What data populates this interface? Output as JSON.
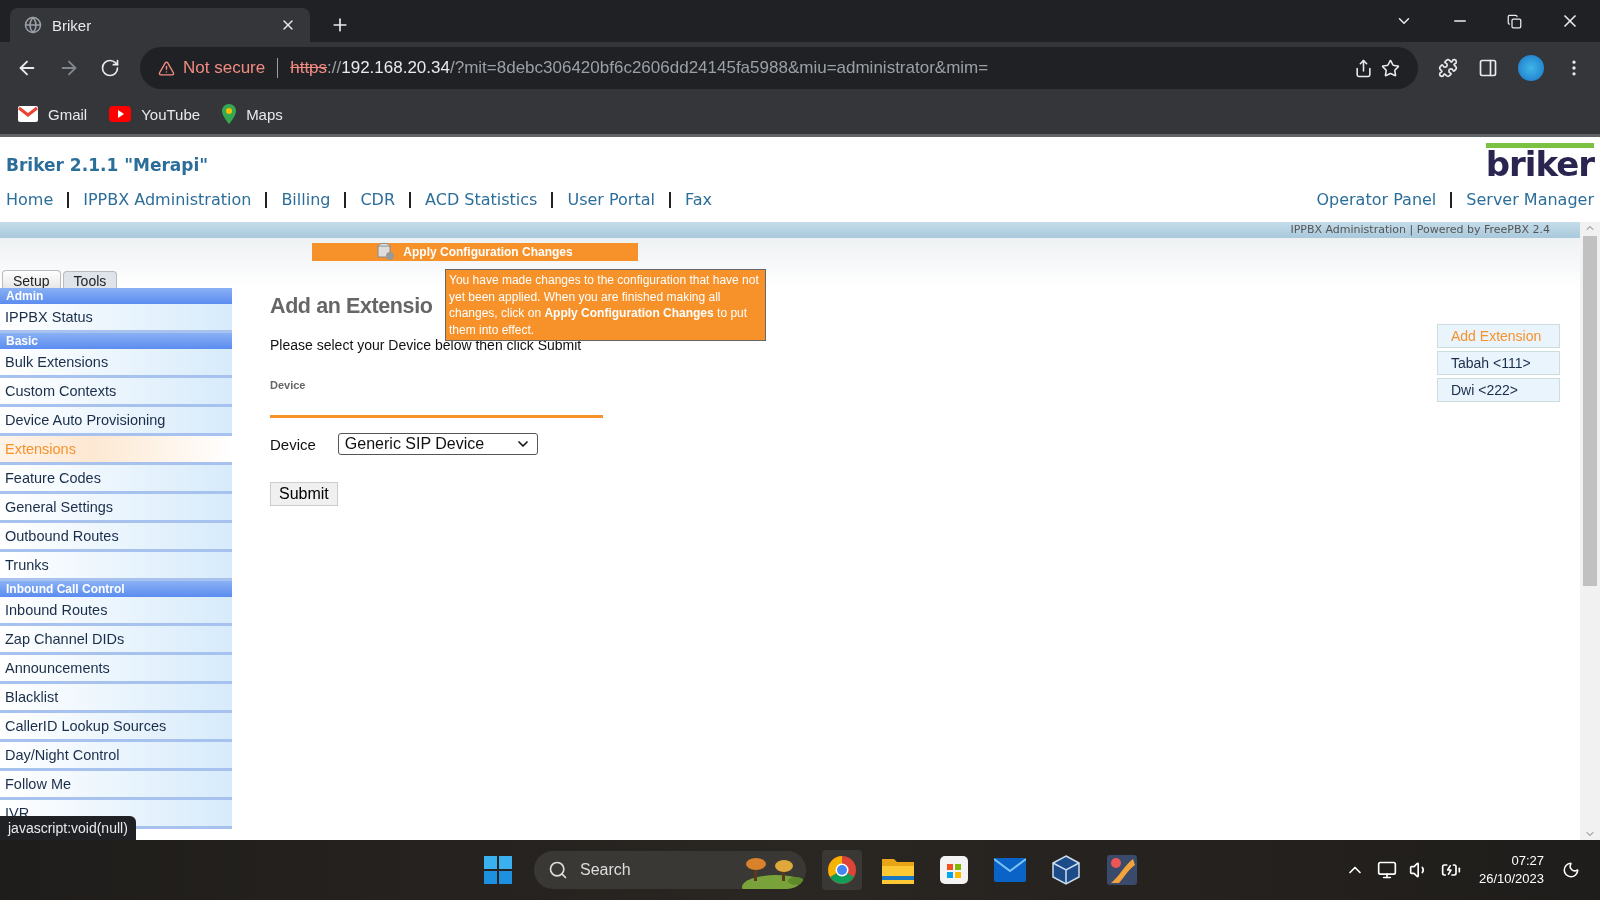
{
  "browser": {
    "tab": {
      "title": "Briker"
    },
    "address": {
      "security": "Not secure",
      "scheme": "https",
      "separator": "://",
      "host": "192.168.20.34",
      "path": "/?mit=8debc306420bf6c2606dd24145fa5988&miu=administrator&mim="
    },
    "bookmarks": [
      {
        "kind": "gmail",
        "label": "Gmail"
      },
      {
        "kind": "youtube",
        "label": "YouTube"
      },
      {
        "kind": "maps",
        "label": "Maps"
      }
    ]
  },
  "page": {
    "title": "Briker 2.1.1 \"Merapi\"",
    "logo": "briker",
    "nav_left": [
      "Home",
      "IPPBX Administration",
      "Billing",
      "CDR",
      "ACD Statistics",
      "User Portal",
      "Fax"
    ],
    "nav_right": [
      "Operator Panel",
      "Server Manager"
    ],
    "banner": "IPPBX Administration | Powered by FreePBX 2.4",
    "apply_button": "Apply Configuration Changes",
    "tooltip": "You have made changes to the configuration that have not yet been applied. When you are finished making all changes, click on **Apply Configuration Changes** to put them into effect.",
    "tabs": [
      {
        "label": "Setup",
        "selected": true
      },
      {
        "label": "Tools",
        "selected": false
      }
    ],
    "sidebar": [
      {
        "header": "Admin",
        "items": [
          {
            "label": "IPPBX Status",
            "selected": false
          }
        ]
      },
      {
        "header": "Basic",
        "items": [
          {
            "label": "Bulk Extensions",
            "selected": false
          },
          {
            "label": "Custom Contexts",
            "selected": false
          },
          {
            "label": "Device Auto Provisioning",
            "selected": false
          },
          {
            "label": "Extensions",
            "selected": true
          },
          {
            "label": "Feature Codes",
            "selected": false
          },
          {
            "label": "General Settings",
            "selected": false
          },
          {
            "label": "Outbound Routes",
            "selected": false
          },
          {
            "label": "Trunks",
            "selected": false
          }
        ]
      },
      {
        "header": "Inbound Call Control",
        "items": [
          {
            "label": "Inbound Routes",
            "selected": false
          },
          {
            "label": "Zap Channel DIDs",
            "selected": false
          },
          {
            "label": "Announcements",
            "selected": false
          },
          {
            "label": "Blacklist",
            "selected": false
          },
          {
            "label": "CallerID Lookup Sources",
            "selected": false
          },
          {
            "label": "Day/Night Control",
            "selected": false
          },
          {
            "label": "Follow Me",
            "selected": false
          },
          {
            "label": "IVR",
            "selected": false
          }
        ]
      }
    ],
    "content": {
      "heading": "Add an Extensio",
      "instruction": "Please select your Device below then click Submit",
      "section": "Device",
      "field_label": "Device",
      "device_value": "Generic SIP Device",
      "submit": "Submit"
    },
    "extension_list": [
      {
        "label": "Add Extension",
        "selected": true
      },
      {
        "label": "Tabah <111>",
        "selected": false
      },
      {
        "label": "Dwi <222>",
        "selected": false
      }
    ],
    "status_link": "javascript:void(null)"
  },
  "taskbar": {
    "search": "Search",
    "time": "07:27",
    "date": "26/10/2023"
  }
}
